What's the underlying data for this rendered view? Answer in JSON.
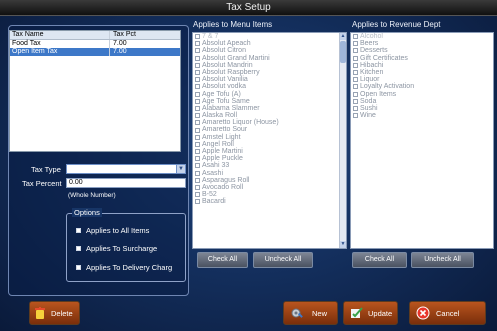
{
  "window": {
    "title": "Tax Setup"
  },
  "tax_table": {
    "headers": {
      "name": "Tax Name",
      "pct": "Tax Pct"
    },
    "rows": [
      {
        "name": "Food Tax",
        "pct": "7.00"
      },
      {
        "name": "Open Item Tax",
        "pct": "7.00"
      }
    ]
  },
  "form": {
    "tax_type_label": "Tax Type",
    "tax_type_value": "",
    "tax_percent_label": "Tax Percent",
    "tax_percent_value": "0.00",
    "whole_number_hint": "(Whole Number)"
  },
  "options": {
    "legend": "Options",
    "items": [
      "Applies to All Items",
      "Applies To Surcharge",
      "Applies  To  Delivery Charg"
    ]
  },
  "menu_items": {
    "title": "Applies to Menu Items",
    "items": [
      "7 & 7",
      "Absolut Apeach",
      "Absolut Citron",
      "Absolut Grand Martini",
      "Absolut Mandrin",
      "Absolut Raspberry",
      "Absolut Vanilia",
      "Absolut vodka",
      "Age Tofu (A)",
      "Age Tofu Same",
      "Alabama Slammer",
      "Alaska Roll",
      "Amaretto Liquor (House)",
      "Amaretto Sour",
      "Amstel Light",
      "Angel Roll",
      "Apple Martini",
      "Apple Puckle",
      "Asahi 33",
      "Asashi",
      "Asparagus Roll",
      "Avocado Roll",
      "B-52",
      "Bacardi"
    ],
    "check_all": "Check All",
    "uncheck_all": "Uncheck All"
  },
  "revenue_dept": {
    "title": "Applies to Revenue Dept",
    "items": [
      "Alcohol",
      "Beers",
      "Desserts",
      "Gift Certificates",
      "Hibachi",
      "Kitchen",
      "Liquor",
      "Loyalty Activation",
      "Open Items",
      "Soda",
      "Sushi",
      "Wine"
    ],
    "check_all": "Check All",
    "uncheck_all": "Uncheck All"
  },
  "footer": {
    "delete": "Delete",
    "new": "New",
    "update": "Update",
    "cancel": "Cancel"
  },
  "icons": {
    "delete": "trash-can-icon",
    "new": "gear-wrench-icon",
    "update": "pencil-check-icon",
    "cancel": "cancel-x-icon"
  },
  "colors": {
    "background": "#14305f",
    "button_orange": "#b9551e",
    "selection_blue": "#3d78c8"
  }
}
